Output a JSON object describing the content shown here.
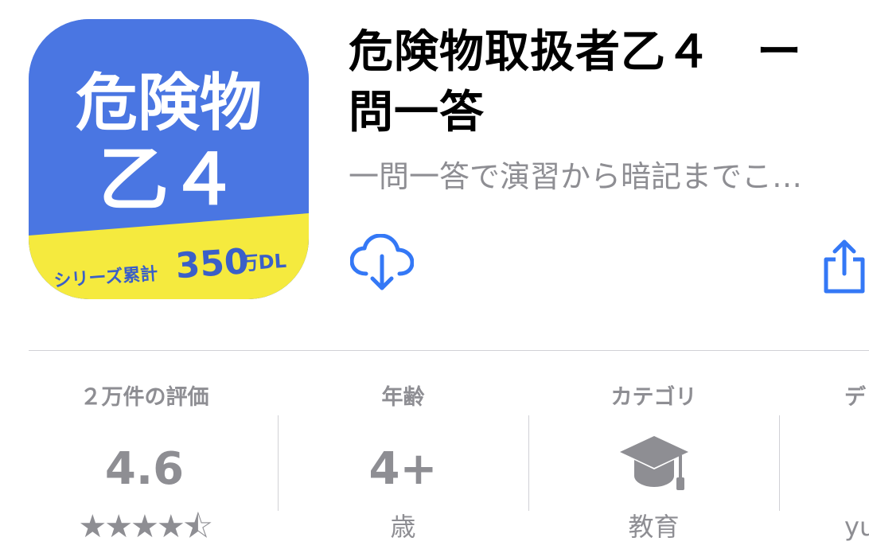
{
  "app": {
    "icon": {
      "line1": "危険物",
      "line2": "乙４",
      "banner_prefix": "シリーズ累計",
      "banner_number": "350",
      "banner_suffix": "万DL",
      "colors": {
        "top": "#4a76e2",
        "banner": "#f5ea3e",
        "text": "#ffffff",
        "banner_text": "#3a5fc8"
      }
    },
    "title": "危険物取扱者乙４　ー\n問一答",
    "subtitle": "一問一答で演習から暗記までこ…",
    "accent": "#3478f6",
    "download_icon": "cloud-download-icon",
    "share_icon": "share-icon"
  },
  "info": {
    "ratings": {
      "header": "２万件の評価",
      "value": "4.6",
      "stars": "★★★★⯪"
    },
    "age": {
      "header": "年齢",
      "value": "4+",
      "sub": "歳"
    },
    "category": {
      "header": "カテゴリ",
      "icon": "graduation-cap-icon",
      "sub": "教育"
    },
    "developer": {
      "header": "デ",
      "sub": "yu"
    }
  }
}
